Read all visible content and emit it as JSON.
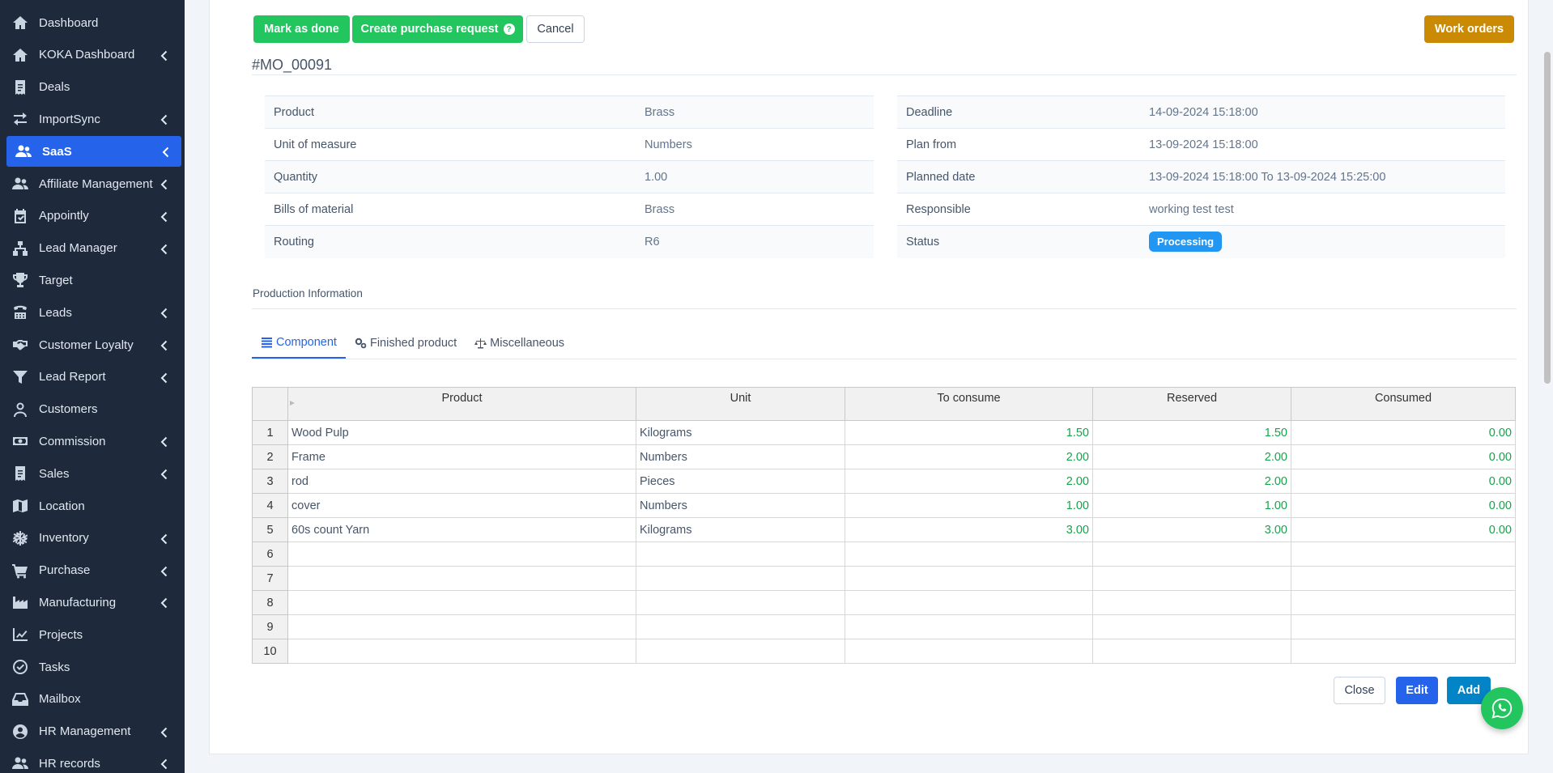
{
  "sidebar": {
    "items": [
      {
        "label": "Dashboard",
        "icon": "home-icon",
        "chevron": false,
        "active": false
      },
      {
        "label": "KOKA Dashboard",
        "icon": "home-icon",
        "chevron": true,
        "active": false
      },
      {
        "label": "Deals",
        "icon": "receipt-icon",
        "chevron": false,
        "active": false
      },
      {
        "label": "ImportSync",
        "icon": "arrows-exchange-icon",
        "chevron": true,
        "active": false
      },
      {
        "label": "SaaS",
        "icon": "users-icon",
        "chevron": true,
        "active": true
      },
      {
        "label": "Affiliate Management",
        "icon": "users-icon",
        "chevron": true,
        "active": false
      },
      {
        "label": "Appointly",
        "icon": "calendar-check-icon",
        "chevron": true,
        "active": false
      },
      {
        "label": "Lead Manager",
        "icon": "sitemap-icon",
        "chevron": true,
        "active": false
      },
      {
        "label": "Target",
        "icon": "trophy-icon",
        "chevron": false,
        "active": false
      },
      {
        "label": "Leads",
        "icon": "tty-icon",
        "chevron": true,
        "active": false
      },
      {
        "label": "Customer Loyalty",
        "icon": "handshake-icon",
        "chevron": true,
        "active": false
      },
      {
        "label": "Lead Report",
        "icon": "filter-icon",
        "chevron": true,
        "active": false
      },
      {
        "label": "Customers",
        "icon": "user-icon",
        "chevron": false,
        "active": false
      },
      {
        "label": "Commission",
        "icon": "money-icon",
        "chevron": true,
        "active": false
      },
      {
        "label": "Sales",
        "icon": "receipt-icon",
        "chevron": true,
        "active": false
      },
      {
        "label": "Location",
        "icon": "map-icon",
        "chevron": false,
        "active": false
      },
      {
        "label": "Inventory",
        "icon": "snowflake-icon",
        "chevron": true,
        "active": false
      },
      {
        "label": "Purchase",
        "icon": "cart-icon",
        "chevron": true,
        "active": false
      },
      {
        "label": "Manufacturing",
        "icon": "industry-icon",
        "chevron": true,
        "active": false
      },
      {
        "label": "Projects",
        "icon": "chart-line-icon",
        "chevron": false,
        "active": false
      },
      {
        "label": "Tasks",
        "icon": "check-circle-icon",
        "chevron": false,
        "active": false
      },
      {
        "label": "Mailbox",
        "icon": "inbox-icon",
        "chevron": false,
        "active": false
      },
      {
        "label": "HR Management",
        "icon": "user-circle-icon",
        "chevron": true,
        "active": false
      },
      {
        "label": "HR records",
        "icon": "users-icon",
        "chevron": true,
        "active": false
      }
    ]
  },
  "toolbar": {
    "mark_done": "Mark as done",
    "create_pr": "Create purchase request",
    "cancel": "Cancel",
    "work_orders": "Work orders"
  },
  "order": {
    "id": "#MO_00091",
    "left": [
      {
        "label": "Product",
        "value": "Brass"
      },
      {
        "label": "Unit of measure",
        "value": "Numbers"
      },
      {
        "label": "Quantity",
        "value": "1.00"
      },
      {
        "label": "Bills of material",
        "value": "Brass"
      },
      {
        "label": "Routing",
        "value": "R6"
      }
    ],
    "right": [
      {
        "label": "Deadline",
        "value": "14-09-2024 15:18:00"
      },
      {
        "label": "Plan from",
        "value": "13-09-2024 15:18:00"
      },
      {
        "label": "Planned date",
        "value": "13-09-2024 15:18:00 To 13-09-2024 15:25:00"
      },
      {
        "label": "Responsible",
        "value": "working test test"
      },
      {
        "label": "Status",
        "value": "Processing"
      }
    ]
  },
  "production": {
    "title": "Production Information",
    "tabs": [
      "Component",
      "Finished product",
      "Miscellaneous"
    ],
    "columns": [
      "Product",
      "Unit",
      "To consume",
      "Reserved",
      "Consumed"
    ],
    "rows": [
      {
        "n": "1",
        "product": "Wood Pulp",
        "unit": "Kilograms",
        "to_consume": "1.50",
        "reserved": "1.50",
        "consumed": "0.00"
      },
      {
        "n": "2",
        "product": "Frame",
        "unit": "Numbers",
        "to_consume": "2.00",
        "reserved": "2.00",
        "consumed": "0.00"
      },
      {
        "n": "3",
        "product": "rod",
        "unit": "Pieces",
        "to_consume": "2.00",
        "reserved": "2.00",
        "consumed": "0.00"
      },
      {
        "n": "4",
        "product": "cover",
        "unit": "Numbers",
        "to_consume": "1.00",
        "reserved": "1.00",
        "consumed": "0.00"
      },
      {
        "n": "5",
        "product": "60s count Yarn",
        "unit": "Kilograms",
        "to_consume": "3.00",
        "reserved": "3.00",
        "consumed": "0.00"
      },
      {
        "n": "6",
        "product": "",
        "unit": "",
        "to_consume": "",
        "reserved": "",
        "consumed": ""
      },
      {
        "n": "7",
        "product": "",
        "unit": "",
        "to_consume": "",
        "reserved": "",
        "consumed": ""
      },
      {
        "n": "8",
        "product": "",
        "unit": "",
        "to_consume": "",
        "reserved": "",
        "consumed": ""
      },
      {
        "n": "9",
        "product": "",
        "unit": "",
        "to_consume": "",
        "reserved": "",
        "consumed": ""
      },
      {
        "n": "10",
        "product": "",
        "unit": "",
        "to_consume": "",
        "reserved": "",
        "consumed": ""
      }
    ]
  },
  "footer": {
    "close": "Close",
    "edit": "Edit",
    "add": "Add"
  },
  "colors": {
    "sidebar_bg": "#1e293b",
    "active": "#2563eb",
    "success": "#22c55e",
    "warning": "#ca8a04",
    "status_badge": "#2196f3",
    "numeric_text": "#16a34a"
  },
  "whatsapp": {
    "icon": "whatsapp-icon"
  }
}
